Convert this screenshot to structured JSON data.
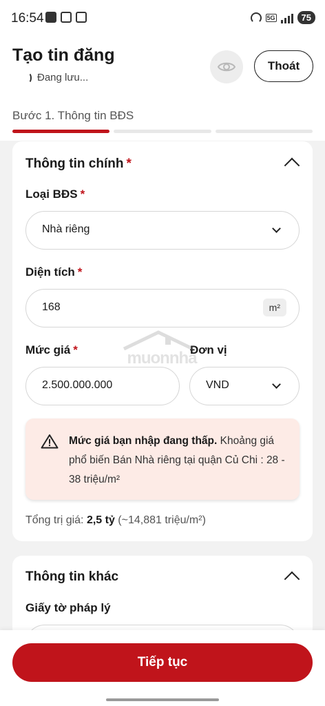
{
  "status_bar": {
    "time": "16:54",
    "battery": "75",
    "network": "5G"
  },
  "header": {
    "title": "Tạo tin đăng",
    "saving": "Đang lưu...",
    "exit_label": "Thoát",
    "step_label": "Bước 1. Thông tin BĐS",
    "progress": {
      "active_step": 1,
      "total_steps": 3
    }
  },
  "main_info": {
    "title": "Thông tin chính",
    "required_mark": "*",
    "property_type": {
      "label": "Loại BĐS",
      "value": "Nhà riêng"
    },
    "area": {
      "label": "Diện tích",
      "value": "168",
      "unit": "m²"
    },
    "price": {
      "label": "Mức giá",
      "value": "2.500.000.000"
    },
    "unit": {
      "label": "Đơn vị",
      "value": "VND"
    },
    "warning": {
      "bold": "Mức giá bạn nhập đang thấp.",
      "text": " Khoảng giá phổ biến Bán Nhà riêng tại quận Củ Chi : 28 - 38 triệu/m²"
    },
    "total": {
      "label": "Tổng trị giá: ",
      "value": "2,5 tỷ",
      "per_unit": " (~14,881 triệu/m²)"
    }
  },
  "watermark": "muonnha",
  "other_info": {
    "title": "Thông tin khác",
    "legal_label": "Giấy tờ pháp lý"
  },
  "footer": {
    "continue_label": "Tiếp tục"
  },
  "colors": {
    "accent": "#c0141b",
    "warning_bg": "#fdebe6"
  }
}
